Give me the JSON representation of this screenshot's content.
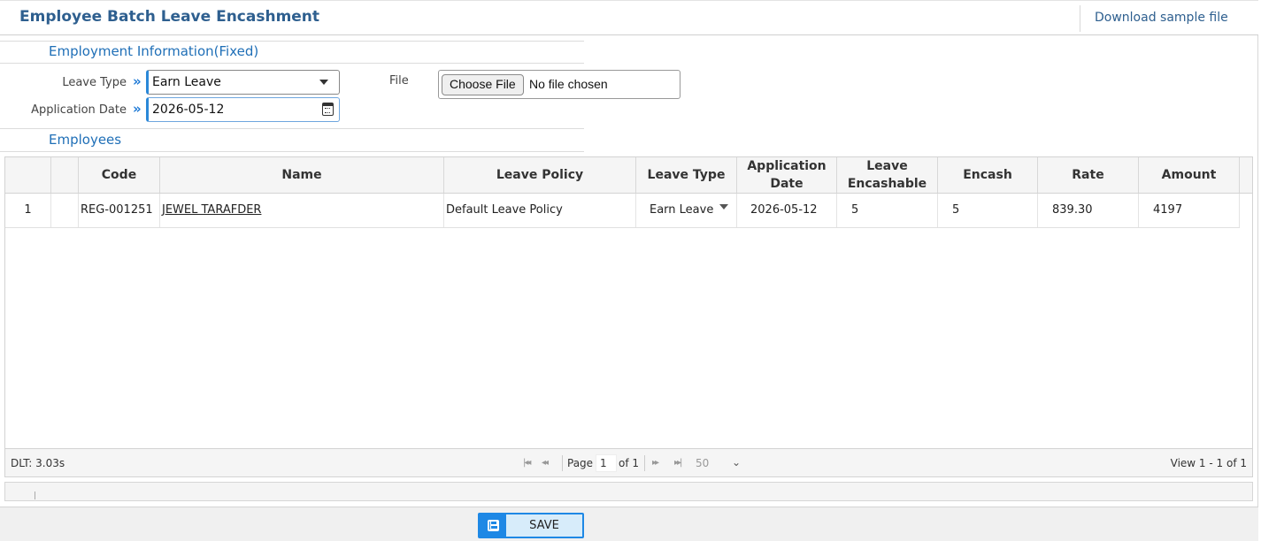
{
  "page": {
    "title": "Employee Batch Leave Encashment",
    "download_link": "Download sample file"
  },
  "employment_info": {
    "section_title": "Employment Information(Fixed)",
    "leave_type": {
      "label": "Leave Type",
      "value": "Earn Leave"
    },
    "application_date": {
      "label": "Application Date",
      "value": "2026-05-12"
    },
    "file": {
      "label": "File",
      "button": "Choose File",
      "status": "No file chosen"
    }
  },
  "employees": {
    "section_title": "Employees",
    "columns": [
      "",
      "",
      "Code",
      "Name",
      "Leave Policy",
      "Leave Type",
      "Application Date",
      "Leave Encashable",
      "Encash",
      "Rate",
      "Amount"
    ],
    "rows": [
      {
        "num": "1",
        "code": "REG-001251",
        "name": "JEWEL TARAFDER",
        "leave_policy": "Default Leave Policy",
        "leave_type": "Earn Leave",
        "application_date": "2026-05-12",
        "leave_encashable": "5",
        "encash": "5",
        "rate": "839.30",
        "amount": "4197"
      }
    ]
  },
  "pager": {
    "dlt": "DLT: 3.03s",
    "page_label": "Page",
    "page_value": "1",
    "of_label": "of 1",
    "rows_per_page": "50",
    "view_label": "View 1 - 1 of 1"
  },
  "footer": {
    "save_label": "SAVE"
  },
  "colors": {
    "title_blue": "#2e5f8f",
    "accent_blue": "#1e88e5",
    "section_blue": "#1f6fb7"
  }
}
